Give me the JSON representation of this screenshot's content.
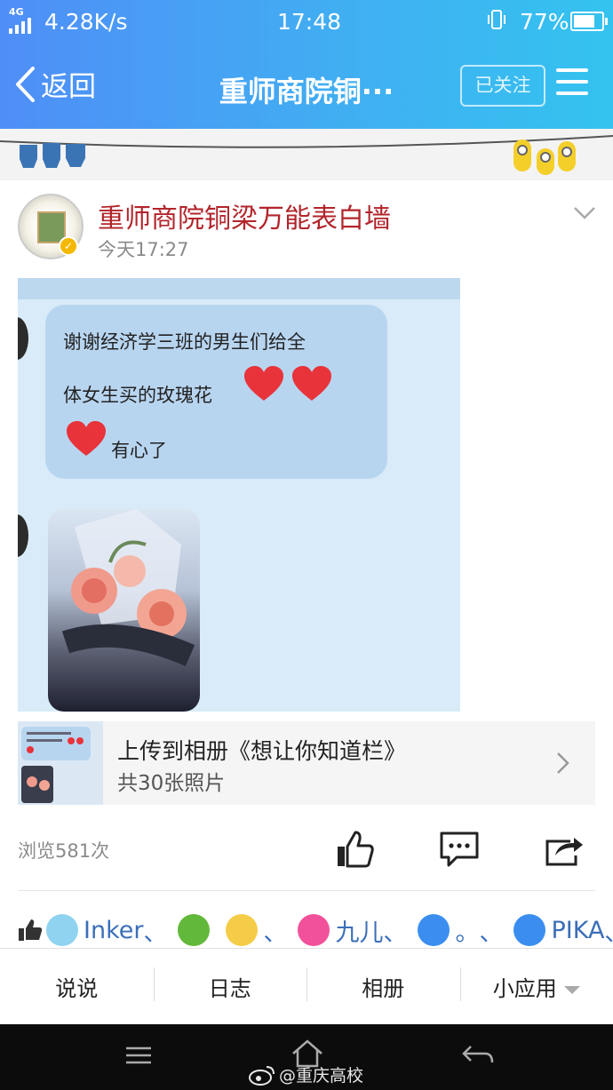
{
  "status_bar": {
    "network_tag": "4G",
    "speed": "4.28K/s",
    "time": "17:48",
    "battery": "77%",
    "battery_level": 0.77
  },
  "nav": {
    "back_label": "返回",
    "title": "重师商院铜···",
    "follow_label": "已关注"
  },
  "post": {
    "author": "重师商院铜梁万能表白墙",
    "time": "今天17:27",
    "chat": {
      "line1": "谢谢经济学三班的男生们给全",
      "line2": "体女生买的玫瑰花",
      "line3": "有心了"
    },
    "album": {
      "title": "上传到相册《想让你知道栏》",
      "count": "共30张照片"
    },
    "views": "浏览581次"
  },
  "likes": [
    {
      "name": "Inker",
      "sep": "、",
      "color": "#8fd3f0"
    },
    {
      "name": "",
      "sep": "",
      "color": "#62b83a"
    },
    {
      "name": "",
      "sep": "、",
      "color": "#f5cc48"
    },
    {
      "name": "九儿",
      "sep": "、",
      "color": "#f0519a"
    },
    {
      "name": "。",
      "sep": "、",
      "color": "#3b8ef0"
    },
    {
      "name": "PIKA",
      "sep": "、",
      "color": "#3b8ef0"
    }
  ],
  "tabs": [
    "说说",
    "日志",
    "相册",
    "小应用"
  ],
  "watermark": "@重庆高校",
  "colors": {
    "nav_gradient_start": "#4f8ef7",
    "nav_gradient_end": "#34c3ef",
    "author": "#b2252b",
    "like_names": "#3b6fb8"
  }
}
